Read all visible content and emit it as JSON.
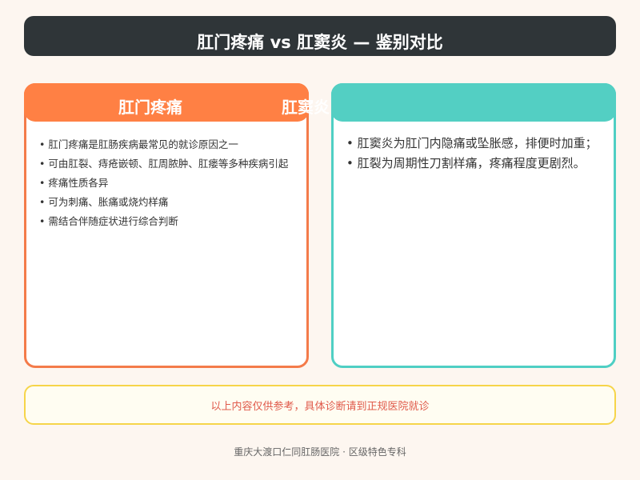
{
  "title": "肛门疼痛 vs 肛窦炎 — 鉴别对比",
  "left_card": {
    "title": "肛门疼痛",
    "points": [
      "肛门疼痛是肛肠疾病最常见的就诊原因之一",
      "可由肛裂、痔疮嵌顿、肛周脓肿、肛瘘等多种疾病引起",
      "疼痛性质各异",
      "可为刺痛、胀痛或烧灼样痛",
      "需结合伴随症状进行综合判断"
    ]
  },
  "right_card": {
    "title": "肛窦炎",
    "points": [
      "肛窦炎为肛门内隐痛或坠胀感，排便时加重；",
      "肛裂为周期性刀割样痛，疼痛程度更剧烈。"
    ]
  },
  "notice": "以上内容仅供参考，具体诊断请到正规医院就诊",
  "footer": "重庆大渡口仁同肛肠医院 · 区级特色专科",
  "colors": {
    "title_bar": "#2f3538",
    "left_accent": "#ff8044",
    "right_accent": "#53cfc3",
    "notice_border": "#f6d54a",
    "notice_text": "#e05a4b",
    "background": "#fdf6f0"
  }
}
